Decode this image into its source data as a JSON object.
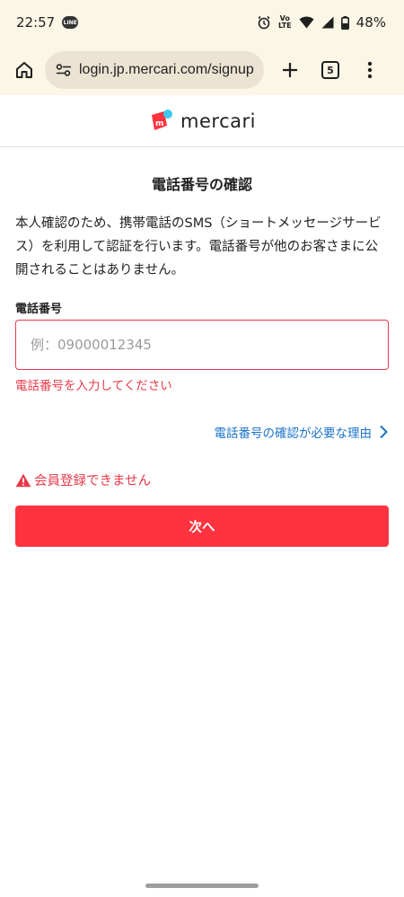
{
  "status_bar": {
    "time": "22:57",
    "app_badge": "LINE",
    "network_label": "LTE",
    "battery": "48%"
  },
  "browser": {
    "url": "login.jp.mercari.com/signup",
    "tab_count": "5"
  },
  "header": {
    "brand": "mercari",
    "brand_color": "#ff333f",
    "brand_dot_color": "#3ccaf0"
  },
  "main": {
    "title": "電話番号の確認",
    "description": "本人確認のため、携帯電話のSMS（ショートメッセージサービス）を利用して認証を行います。電話番号が他のお客さまに公開されることはありません。",
    "phone_field": {
      "label": "電話番号",
      "placeholder": "例：09000012345",
      "value": ""
    },
    "error": "電話番号を入力してください",
    "reason_link": "電話番号の確認が必要な理由",
    "alert": "会員登録できません",
    "next_button": "次へ"
  },
  "colors": {
    "accent": "#ff333f",
    "error": "#e8394a",
    "link": "#1a73c8",
    "chrome_bg": "#fcf6e6"
  }
}
